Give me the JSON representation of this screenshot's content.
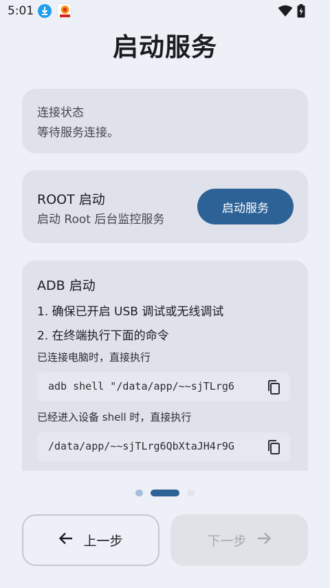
{
  "status_bar": {
    "time": "5:01"
  },
  "page": {
    "title": "启动服务"
  },
  "connection_status": {
    "label": "连接状态",
    "value": "等待服务连接。"
  },
  "root_section": {
    "title": "ROOT 启动",
    "description": "启动 Root 后台监控服务",
    "button_label": "启动服务"
  },
  "adb_section": {
    "title": "ADB 启动",
    "step1": "1. 确保已开启 USB 调试或无线调试",
    "step2": "2. 在终端执行下面的命令",
    "pc_note": "已连接电脑时，直接执行",
    "pc_command": "adb shell \"/data/app/~~sjTLrg6",
    "device_note": "已经进入设备 shell 时，直接执行",
    "device_command": "/data/app/~~sjTLrg6QbXtaJH4r9G"
  },
  "pager": {
    "total": 3,
    "current": 2
  },
  "nav": {
    "prev_label": "上一步",
    "next_label": "下一步"
  }
}
